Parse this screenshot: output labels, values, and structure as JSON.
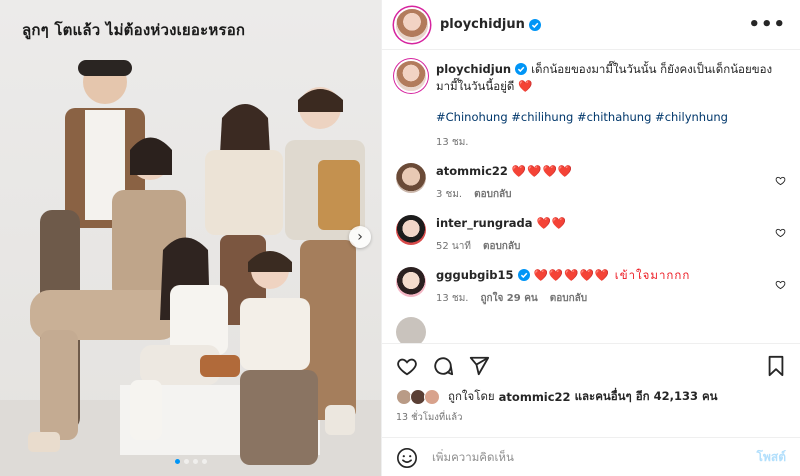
{
  "photo": {
    "caption": "ลูกๆ โตแล้ว   ไม่ต้องห่วงเยอะหรอก"
  },
  "header": {
    "username": "ploychidjun",
    "more_label": "•••"
  },
  "post": {
    "username": "ploychidjun",
    "caption": "เด็กน้อยของมามี๊ในวันนั้น ก็ยังคงเป็นเด็กน้อยของมามี๊ในวันนี้อยู่ดี",
    "caption_heart": "❤️",
    "hashtags": "#Chinohung #chilihung #chithahung #chilynhung",
    "time": "13 ชม."
  },
  "comments": [
    {
      "username": "atommic22",
      "text": "❤️❤️❤️❤️",
      "time": "3 ชม.",
      "likes": "",
      "reply": "ตอบกลับ"
    },
    {
      "username": "inter_rungrada",
      "text": "❤️❤️",
      "time": "52 นาที",
      "likes": "",
      "reply": "ตอบกลับ"
    },
    {
      "username": "gggubgib15",
      "text": "❤️❤️❤️❤️❤️ เข้าใจมากกก",
      "time": "13 ชม.",
      "likes": "ถูกใจ 29 คน",
      "reply": "ตอบกลับ"
    }
  ],
  "likes": {
    "prefix": "ถูกใจโดย",
    "user": "atommic22",
    "rest": "และคนอื่นๆ อีก 42,133 คน"
  },
  "posted_ago": "13 ชั่วโมงที่แล้ว",
  "add_comment": {
    "placeholder": "เพิ่มความคิดเห็น",
    "post_label": "โพสต์"
  },
  "colors": {
    "verified": "#0095f6",
    "heart": "#ed1c24",
    "link": "#00376b"
  }
}
